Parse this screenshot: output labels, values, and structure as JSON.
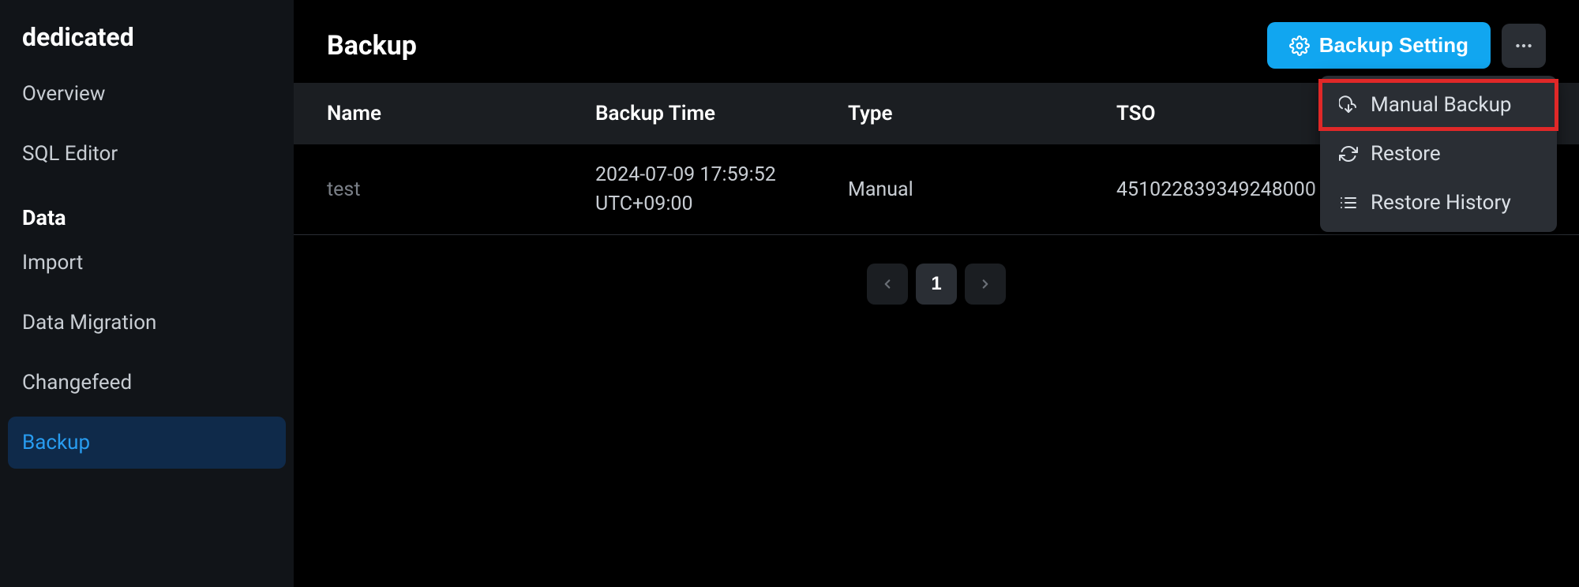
{
  "sidebar": {
    "title": "dedicated",
    "main_items": [
      {
        "label": "Overview"
      },
      {
        "label": "SQL Editor"
      }
    ],
    "data_section": {
      "title": "Data",
      "items": [
        {
          "label": "Import",
          "active": false
        },
        {
          "label": "Data Migration",
          "active": false
        },
        {
          "label": "Changefeed",
          "active": false
        },
        {
          "label": "Backup",
          "active": true
        }
      ]
    }
  },
  "page": {
    "title": "Backup",
    "backup_setting_button": "Backup Setting"
  },
  "table": {
    "headers": {
      "name": "Name",
      "backup_time": "Backup Time",
      "type": "Type",
      "tso": "TSO"
    },
    "rows": [
      {
        "name": "test",
        "backup_time_line1": "2024-07-09 17:59:52",
        "backup_time_line2": "UTC+09:00",
        "type": "Manual",
        "tso": "451022839349248000"
      }
    ]
  },
  "pagination": {
    "current": "1"
  },
  "dropdown": {
    "items": [
      {
        "label": "Manual Backup",
        "highlighted": true,
        "icon": "cloud-download"
      },
      {
        "label": "Restore",
        "highlighted": false,
        "icon": "refresh"
      },
      {
        "label": "Restore History",
        "highlighted": false,
        "icon": "list"
      }
    ]
  }
}
